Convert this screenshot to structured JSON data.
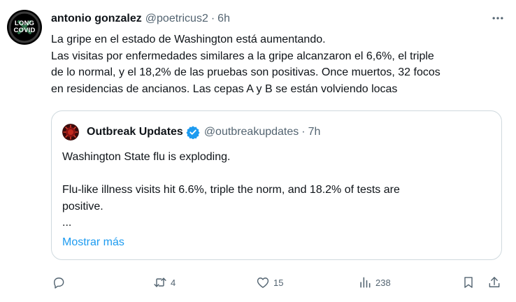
{
  "post": {
    "author_name": "antonio gonzalez",
    "author_handle": "@poetricus2",
    "separator": "·",
    "time": "6h",
    "avatar_text_top": "LONG",
    "avatar_text_bottom": "COVID",
    "lines": [
      "La gripe en el estado de Washington está aumentando.",
      "Las visitas por enfermedades similares a la gripe alcanzaron el 6,6%, el triple",
      "de lo normal, y el 18,2% de las pruebas son positivas. Once muertos, 32 focos",
      "en residencias de ancianos. Las cepas A y B se están volviendo locas"
    ]
  },
  "quote": {
    "author_name": "Outbreak Updates",
    "author_handle": "@outbreakupdates",
    "separator": "·",
    "time": "7h",
    "line1": "Washington State flu is exploding.",
    "line2": "Flu-like illness visits hit 6.6%, triple the norm, and 18.2% of tests are",
    "line3": "positive.",
    "line4": "...",
    "show_more": "Mostrar más"
  },
  "actions": {
    "replies": "",
    "reposts": "4",
    "likes": "15",
    "views": "238"
  },
  "colors": {
    "text": "#0f1419",
    "secondary": "#536471",
    "accent": "#1d9bf0",
    "border": "#cfd9de"
  },
  "icons": [
    "more-icon",
    "verified-badge-icon",
    "reply-icon",
    "repost-icon",
    "like-icon",
    "views-icon",
    "bookmark-icon",
    "share-icon"
  ]
}
